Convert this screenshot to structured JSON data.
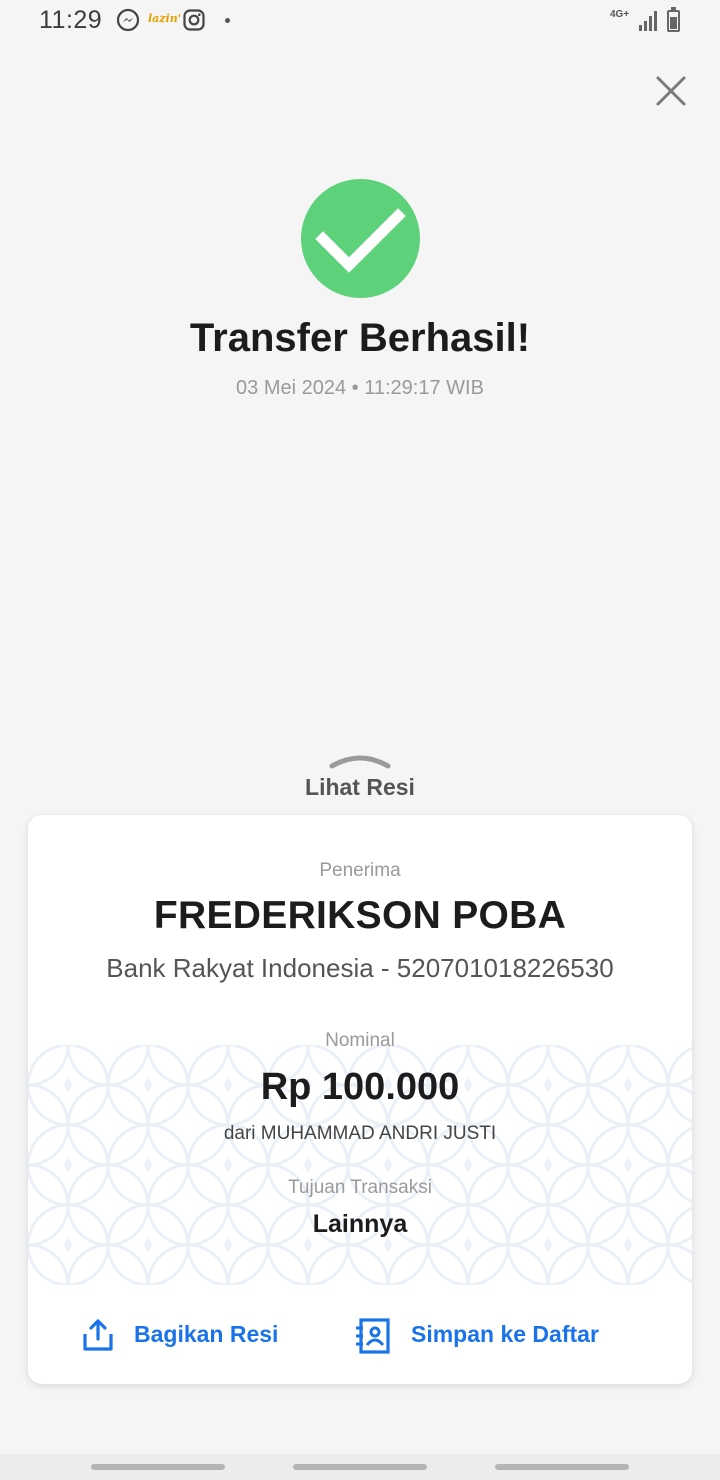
{
  "status_bar": {
    "time": "11:29",
    "lazada_text": "lazin'",
    "network": "4G+"
  },
  "success": {
    "title": "Transfer Berhasil!",
    "datetime": "03 Mei 2024 • 11:29:17 WIB",
    "icon_color": "#5dd27a"
  },
  "lihat_resi": {
    "label": "Lihat Resi"
  },
  "receipt": {
    "recipient_label": "Penerima",
    "recipient_name": "FREDERIKSON POBA",
    "recipient_account": "Bank Rakyat Indonesia - 520701018226530",
    "nominal_label": "Nominal",
    "nominal_amount": "Rp 100.000",
    "sender": "dari MUHAMMAD ANDRI JUSTI",
    "purpose_label": "Tujuan Transaksi",
    "purpose_value": "Lainnya"
  },
  "actions": {
    "share_label": "Bagikan Resi",
    "save_label": "Simpan ke Daftar",
    "accent_color": "#1a73e8"
  },
  "icons": {
    "close": "close-icon",
    "success": "check-icon",
    "share": "share-icon",
    "save": "contact-save-icon"
  }
}
